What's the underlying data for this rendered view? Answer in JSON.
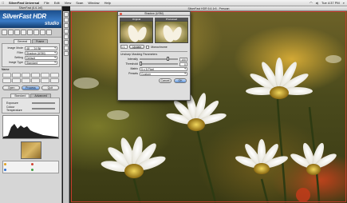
{
  "menubar": {
    "app_name": "SilverFast Universal",
    "items": [
      "File",
      "Edit",
      "View",
      "Scan",
      "Window",
      "Help"
    ],
    "clock": "Tue 4:37 PM"
  },
  "panel": {
    "title": "SilverFast (6.6.1r6)",
    "brand_name": "SilverFast HDR",
    "brand_sub": "studio",
    "tabs": [
      "General",
      "Frame"
    ],
    "fields": [
      {
        "label": "Image Mode",
        "value": "48 → 24 Bit"
      },
      {
        "label": "Filter",
        "value": "Shadow (USM)"
      },
      {
        "label": "Setting",
        "value": "Default"
      },
      {
        "label": "Image Type",
        "value": "Standard"
      }
    ],
    "frame_label": "Name",
    "buttons": {
      "open": "Open",
      "process": "Process",
      "quit": "Quit"
    },
    "sub_tabs": [
      "Standard",
      "Advanced"
    ],
    "sliders": [
      "Exposure",
      "Colour Temperature"
    ]
  },
  "prescan": {
    "title": "SilverFast HDR 6.6.1r6 - Prescan"
  },
  "dialog": {
    "title": "Shadow (USM)",
    "before_label": "Original",
    "after_label": "Processed",
    "zoom_value": "1:1",
    "update_label": "Update",
    "monochrome_label": "Monochrome",
    "section_label": "Unsharp Masking Parameters",
    "intensity_label": "Intensity",
    "intensity_value": "100",
    "threshold_label": "Threshold",
    "threshold_value": "0",
    "matrix_label": "Matrix",
    "matrix_value": "5 x 5 Pixel",
    "presets_label": "Presets",
    "presets_value": "Custom",
    "cancel_label": "Cancel",
    "ok_label": "OK"
  }
}
